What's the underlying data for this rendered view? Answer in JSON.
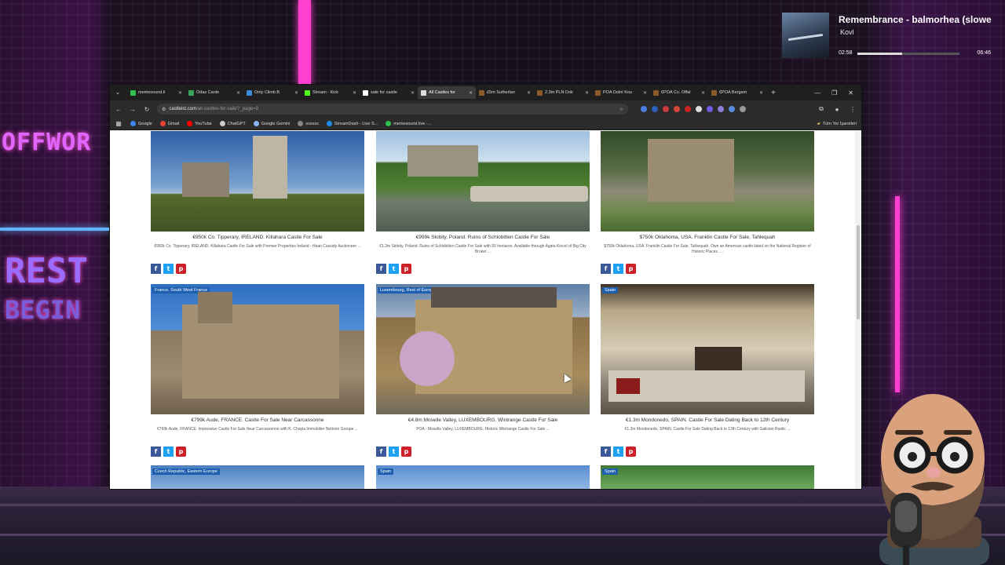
{
  "now_playing": {
    "title": "Remembrance - balmorhea (slowe",
    "artist": "Kovl",
    "elapsed": "02:58",
    "duration": "06:46",
    "progress": 0.44
  },
  "browser": {
    "tabs": [
      {
        "label": "memesound.li",
        "color": "#2fbf4f",
        "active": false
      },
      {
        "label": "Odas Canle",
        "color": "#3ba55d",
        "active": false
      },
      {
        "label": "Only Climb B",
        "color": "#3a8bd8",
        "active": false
      },
      {
        "label": "Stream - Kick",
        "color": "#53fc18",
        "active": false
      },
      {
        "label": "sale for castle",
        "color": "#ffffff",
        "active": false
      },
      {
        "label": "All Castles for",
        "color": "#dddddd",
        "active": true
      },
      {
        "label": "£5m Sutherlan",
        "color": "#8a5a2b",
        "active": false
      },
      {
        "label": "2.3m PLN Dolr",
        "color": "#8a5a2b",
        "active": false
      },
      {
        "label": "POA Dolní Kou",
        "color": "#8a5a2b",
        "active": false
      },
      {
        "label": "€POA Co. Offal",
        "color": "#8a5a2b",
        "active": false
      },
      {
        "label": "€POA Bergam",
        "color": "#8a5a2b",
        "active": false
      }
    ],
    "url_host": "castleist.com",
    "url_path": "/all-castles-for-sale/?_page=9",
    "bookmarks": [
      {
        "label": "Google",
        "color": "#4285f4"
      },
      {
        "label": "Gmail",
        "color": "#ea4335"
      },
      {
        "label": "YouTube",
        "color": "#ff0000"
      },
      {
        "label": "ChatGPT",
        "color": "#cccccc"
      },
      {
        "label": "Google Gemini",
        "color": "#8ab4f8"
      },
      {
        "label": "ssssss",
        "color": "#888888"
      },
      {
        "label": "StreamDash - Live S...",
        "color": "#1e88e5"
      },
      {
        "label": "memesound.live -...",
        "color": "#2fbf4f"
      }
    ],
    "bookmarks_right": "Tüm Yer İşaretleri"
  },
  "listings": [
    {
      "title": "€950k Co. Tipperary, IRELAND. Killahara Castle For Sale",
      "desc": "€950k Co. Tipperary, IRELAND. Killahara Castle For Sale with Premier Properties Ireland - Hean Cassidy Auctioneer ...",
      "region": ""
    },
    {
      "title": "€999k Słobity, Poland. Ruins of Schlobitten Castle For Sale",
      "desc": "€1.2m Słobity, Poland. Ruins of Schlobitten Castle For Sale with 55 hectares. Available through Agata Kincel of Big City Broker ...",
      "region": ""
    },
    {
      "title": "$750k Oklahoma, USA. Franklin Castle For Sale, Tahlequah",
      "desc": "$750k Oklahoma, USA. Franklin Castle For Sale, Tahlequah. Own an American castle listed on the National Register of Historic Places. ...",
      "region": ""
    },
    {
      "title": "€799k Aude, FRANCE. Castle For Sale Near Carcassonne",
      "desc": "€799k Aude, FRANCE. Impressive Castle For Sale Near Carcassonne with K. Chayla Immobilier Nettonn Groupe ...",
      "region": "France, South West France"
    },
    {
      "title": "€4.8m Moselle Valley, LUXEMBOURG. Wintrange Castle For Sale",
      "desc": "POA - Moselle Valley, LUXEMBOURG. Historic Wintrange Castle For Sale ...",
      "region": "Luxembourg, Rest of Europe"
    },
    {
      "title": "€1.3m Mondonedo, SPAIN. Castle For Sale Dating Back to 12th Century",
      "desc": "€1.3m Mondonedo, SPAIN. Castle For Sale Dating Back to 12th Century with Galician Rustic ...",
      "region": "Spain"
    },
    {
      "title": "",
      "desc": "",
      "region": "Czech Republic, Eastern Europe"
    },
    {
      "title": "",
      "desc": "",
      "region": "Spain"
    },
    {
      "title": "",
      "desc": "",
      "region": "Spain"
    }
  ],
  "share_icons": [
    "facebook-icon",
    "twitter-icon",
    "pinterest-icon"
  ],
  "colors": {
    "facebook": "#3b5998",
    "twitter": "#1da1f2",
    "pinterest": "#cb2027",
    "region_tag": "#1d5fae",
    "neon_pink": "#ff3fd0"
  }
}
